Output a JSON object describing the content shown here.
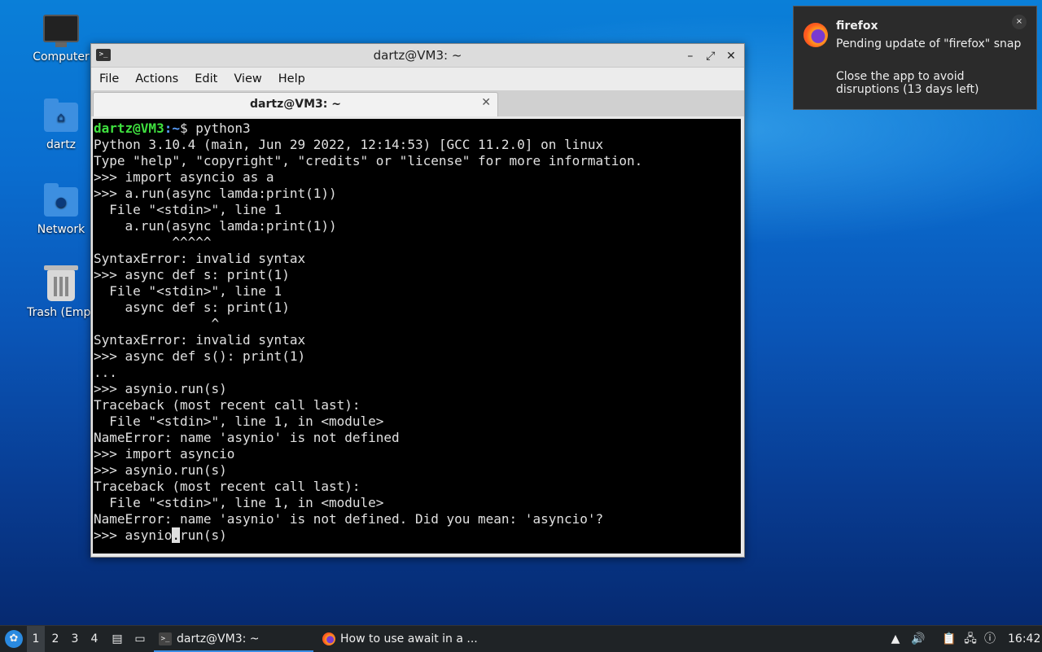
{
  "desktop": {
    "icons": [
      {
        "label": "Computer"
      },
      {
        "label": "dartz"
      },
      {
        "label": "Network"
      },
      {
        "label": "Trash (Empt"
      }
    ]
  },
  "window": {
    "title": "dartz@VM3: ~",
    "menu": [
      "File",
      "Actions",
      "Edit",
      "View",
      "Help"
    ],
    "tab_title": "dartz@VM3: ~",
    "prompt_user": "dartz@VM3",
    "prompt_path": ":~",
    "prompt_cmd": "$ python3",
    "lines": [
      "Python 3.10.4 (main, Jun 29 2022, 12:14:53) [GCC 11.2.0] on linux",
      "Type \"help\", \"copyright\", \"credits\" or \"license\" for more information.",
      ">>> import asyncio as a",
      ">>> a.run(async lamda:print(1))",
      "  File \"<stdin>\", line 1",
      "    a.run(async lamda:print(1))",
      "          ^^^^^",
      "SyntaxError: invalid syntax",
      ">>> async def s: print(1)",
      "  File \"<stdin>\", line 1",
      "    async def s: print(1)",
      "               ^",
      "SyntaxError: invalid syntax",
      ">>> async def s(): print(1)",
      "...",
      ">>> asynio.run(s)",
      "Traceback (most recent call last):",
      "  File \"<stdin>\", line 1, in <module>",
      "NameError: name 'asynio' is not defined",
      ">>> import asyncio",
      ">>> asynio.run(s)",
      "Traceback (most recent call last):",
      "  File \"<stdin>\", line 1, in <module>",
      "NameError: name 'asynio' is not defined. Did you mean: 'asyncio'?"
    ],
    "current_before": ">>> asynio",
    "current_cursor": ".",
    "current_after": "run(s)"
  },
  "notification": {
    "app": "firefox",
    "line1": "Pending update of \"firefox\" snap",
    "line2": "Close the app to avoid disruptions (13 days left)",
    "close": "×"
  },
  "taskbar": {
    "workspaces": [
      "1",
      "2",
      "3",
      "4"
    ],
    "tasks": [
      {
        "label": "dartz@VM3: ~"
      },
      {
        "label": "How to use await in a ..."
      }
    ],
    "clock": "16:42"
  }
}
